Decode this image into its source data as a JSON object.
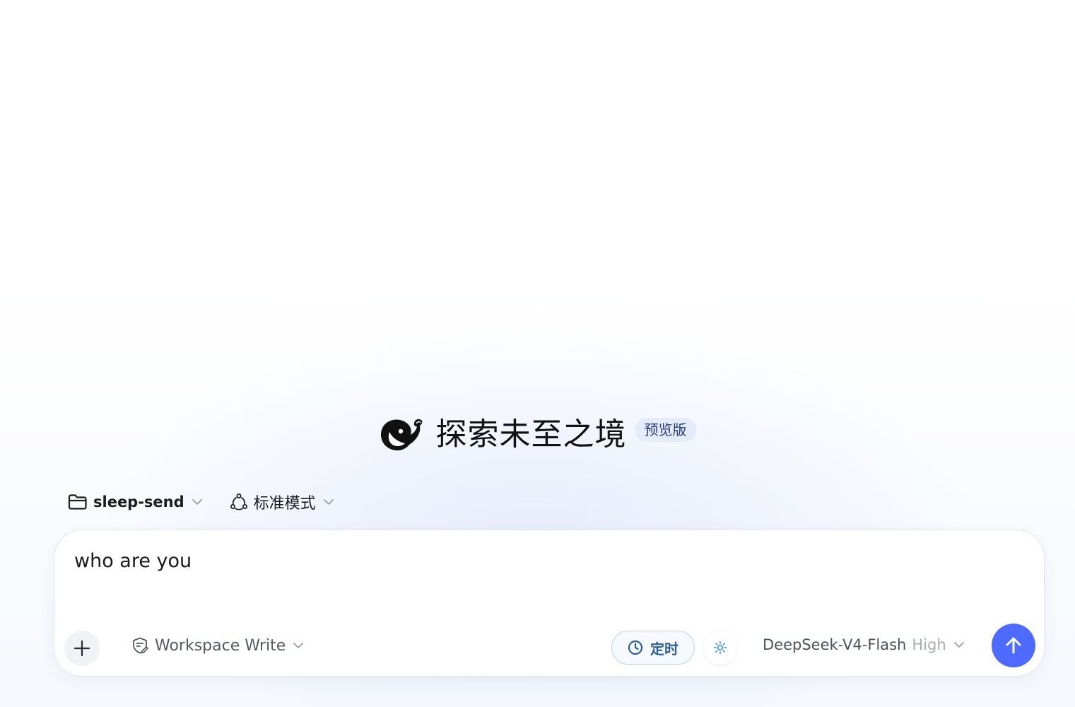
{
  "hero": {
    "title": "探索未至之境",
    "badge": "预览版",
    "logo_icon": "deepseek-whale-icon"
  },
  "selectors": {
    "folder": {
      "label": "sleep-send",
      "icon": "folder-icon"
    },
    "mode": {
      "label": "标准模式",
      "icon": "mode-cycle-icon"
    }
  },
  "composer": {
    "input_value": "who are you",
    "permission": {
      "label": "Workspace Write",
      "icon": "shield-edit-icon"
    },
    "schedule": {
      "label": "定时",
      "icon": "clock-icon"
    },
    "model": {
      "name": "DeepSeek-V4-Flash",
      "level": "High"
    },
    "send_icon": "arrow-up-icon"
  },
  "colors": {
    "accent": "#4d6bfe",
    "schedule_text": "#2d5f95",
    "badge_bg": "#e4ebfb"
  }
}
